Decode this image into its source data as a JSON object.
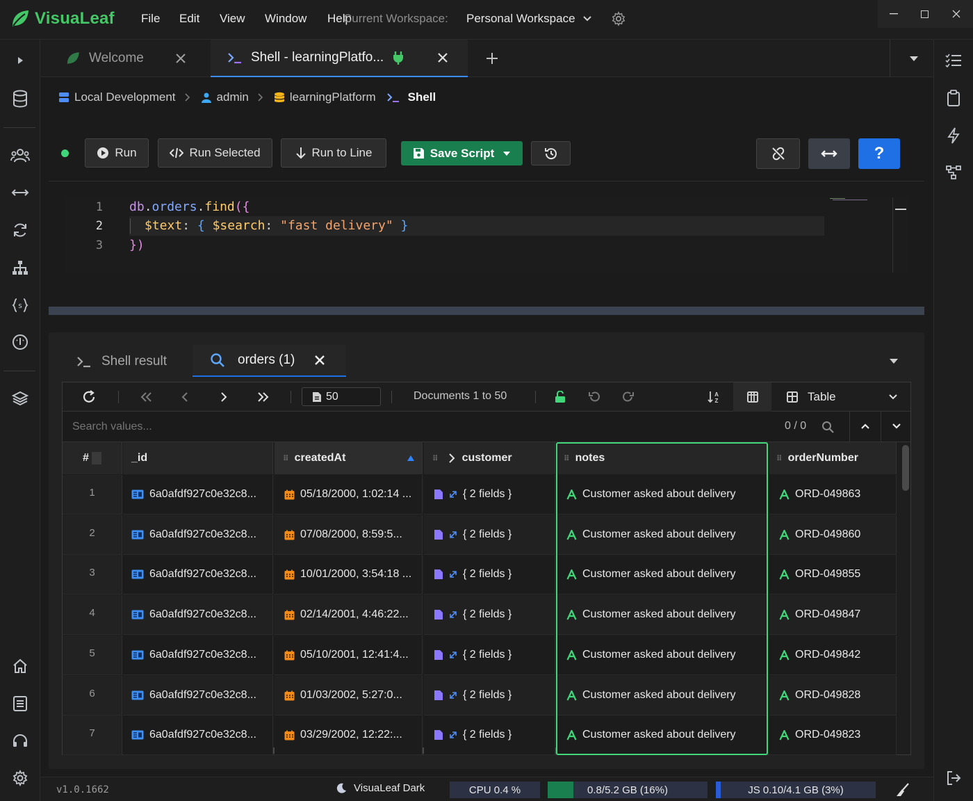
{
  "app": {
    "name": "VisuaLeaf",
    "version": "v1.0.1662",
    "theme": "VisuaLeaf Dark"
  },
  "menu": [
    "File",
    "Edit",
    "View",
    "Window",
    "Help"
  ],
  "workspace": {
    "label": "Current Workspace:",
    "value": "Personal Workspace"
  },
  "tabs": [
    {
      "label": "Welcome",
      "active": false
    },
    {
      "label": "Shell - learningPlatfo...",
      "active": true
    }
  ],
  "breadcrumb": [
    "Local Development",
    "admin",
    "learningPlatform",
    "Shell"
  ],
  "toolbar": {
    "run": "Run",
    "run_selected": "Run Selected",
    "run_to_line": "Run to Line",
    "save_script": "Save Script",
    "help": "?"
  },
  "editor": {
    "line_numbers": [
      "1",
      "2",
      "3"
    ],
    "lines": [
      {
        "a": "db",
        "b": ".",
        "c": "orders",
        "d": ".",
        "e": "find",
        "f": "({"
      },
      {
        "a": "$text",
        "b": ": ",
        "c": "{ ",
        "d": "$search",
        "e": ": ",
        "f": "\"fast delivery\"",
        "g": " }"
      },
      {
        "a": "})"
      }
    ]
  },
  "result_tabs": [
    {
      "label": "Shell result",
      "active": false
    },
    {
      "label": "orders (1)",
      "active": true
    }
  ],
  "grid_toolbar": {
    "page_size": "50",
    "documents_label": "Documents 1 to 50",
    "view_mode": "Table",
    "search_placeholder": "Search values...",
    "search_count": "0 / 0"
  },
  "columns": [
    "#",
    "_id",
    "createdAt",
    "customer",
    "notes",
    "orderNumber"
  ],
  "rows": [
    {
      "n": "1",
      "id": "6a0afdf927c0e32c8...",
      "created": "05/18/2000, 1:02:14 ...",
      "customer": "{ 2 fields }",
      "notes": "Customer asked about delivery",
      "order": "ORD-049863"
    },
    {
      "n": "2",
      "id": "6a0afdf927c0e32c8...",
      "created": "07/08/2000, 8:59:5...",
      "customer": "{ 2 fields }",
      "notes": "Customer asked about delivery",
      "order": "ORD-049860"
    },
    {
      "n": "3",
      "id": "6a0afdf927c0e32c8...",
      "created": "10/01/2000, 3:54:18 ...",
      "customer": "{ 2 fields }",
      "notes": "Customer asked about delivery",
      "order": "ORD-049855"
    },
    {
      "n": "4",
      "id": "6a0afdf927c0e32c8...",
      "created": "02/14/2001, 4:46:22...",
      "customer": "{ 2 fields }",
      "notes": "Customer asked about delivery",
      "order": "ORD-049847"
    },
    {
      "n": "5",
      "id": "6a0afdf927c0e32c8...",
      "created": "05/10/2001, 12:41:4...",
      "customer": "{ 2 fields }",
      "notes": "Customer asked about delivery",
      "order": "ORD-049842"
    },
    {
      "n": "6",
      "id": "6a0afdf927c0e32c8...",
      "created": "01/03/2002, 5:27:0...",
      "customer": "{ 2 fields }",
      "notes": "Customer asked about delivery",
      "order": "ORD-049828"
    },
    {
      "n": "7",
      "id": "6a0afdf927c0e32c8...",
      "created": "03/29/2002, 12:22:...",
      "customer": "{ 2 fields }",
      "notes": "Customer asked about delivery",
      "order": "ORD-049823"
    }
  ],
  "status": {
    "cpu": "CPU 0.4 %",
    "memory": "0.8/5.2 GB (16%)",
    "memory_fraction": 0.16,
    "js": "JS 0.10/4.1 GB (3%)",
    "js_fraction": 0.03
  },
  "colors": {
    "accent_blue": "#1f6fe5",
    "accent_green": "#1a7f4e",
    "highlight_green": "#3fd77a",
    "leaf_green": "#44c767"
  }
}
